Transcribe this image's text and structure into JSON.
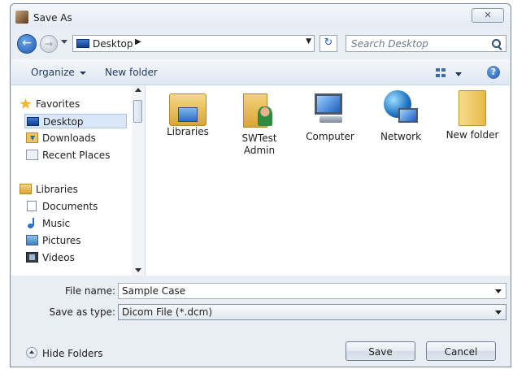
{
  "window": {
    "title": "Save As",
    "close_glyph": "✕"
  },
  "nav": {
    "back_glyph": "←",
    "forward_glyph": "→",
    "address": "Desktop",
    "address_separator": "▶",
    "refresh_glyph": "↻",
    "search_placeholder": "Search Desktop"
  },
  "toolbar": {
    "organize_label": "Organize",
    "new_folder_label": "New folder",
    "help_glyph": "?"
  },
  "sidebar": {
    "items": [
      {
        "label": "Favorites",
        "icon": "star-icon"
      },
      {
        "label": "Desktop",
        "icon": "desktop-icon",
        "selected": true
      },
      {
        "label": "Downloads",
        "icon": "downloads-icon"
      },
      {
        "label": "Recent Places",
        "icon": "recent-places-icon"
      },
      {
        "label": "Libraries",
        "icon": "libraries-icon"
      },
      {
        "label": "Documents",
        "icon": "documents-icon"
      },
      {
        "label": "Music",
        "icon": "music-icon"
      },
      {
        "label": "Pictures",
        "icon": "pictures-icon"
      },
      {
        "label": "Videos",
        "icon": "videos-icon"
      }
    ]
  },
  "content": {
    "items": [
      {
        "label": "Libraries",
        "icon": "libraries-folder-icon"
      },
      {
        "label": "SWTest Admin",
        "icon": "user-folder-icon"
      },
      {
        "label": "Computer",
        "icon": "computer-icon"
      },
      {
        "label": "Network",
        "icon": "network-icon"
      },
      {
        "label": "New folder",
        "icon": "folder-icon"
      }
    ]
  },
  "form": {
    "file_name_label": "File name:",
    "file_name_value": "Sample Case",
    "save_type_label": "Save as type:",
    "save_type_value": "Dicom File (*.dcm)"
  },
  "footer": {
    "hide_folders_label": "Hide Folders",
    "save_label": "Save",
    "cancel_label": "Cancel"
  },
  "colors": {
    "accent": "#1f64c8",
    "chrome": "#e9eef5",
    "selection": "#d9e7f8"
  }
}
